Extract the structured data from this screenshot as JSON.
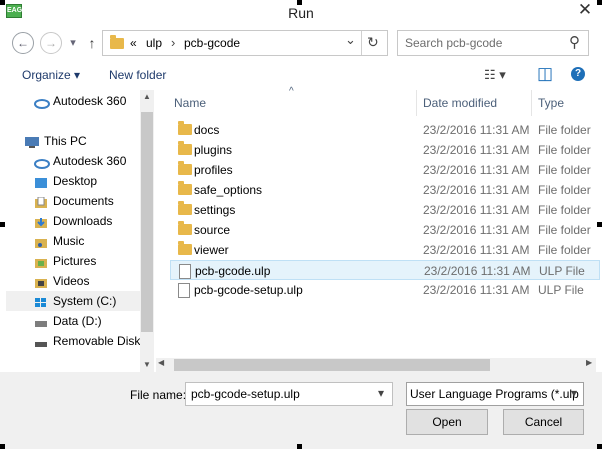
{
  "window": {
    "title": "Run",
    "close_glyph": "✕",
    "app_icon_text": "EAGLE"
  },
  "navigation": {
    "back_glyph": "←",
    "forward_glyph": "→",
    "recent_glyph": "▾",
    "up_glyph": "↑",
    "breadcrumb": {
      "overflow": "«",
      "sep": "›",
      "items": [
        "ulp",
        "pcb-gcode"
      ]
    },
    "dropdown_glyph": "⌄",
    "refresh_glyph": "↻"
  },
  "search": {
    "placeholder": "Search pcb-gcode",
    "icon_glyph": "⚲"
  },
  "toolbar": {
    "organize_label": "Organize ▾",
    "new_folder_label": "New folder",
    "view_glyph": "☷ ▾",
    "pane_glyph": "◫",
    "help_glyph": "?"
  },
  "sidebar": {
    "items": [
      {
        "label": "Autodesk 360",
        "icon": "cloud-icon",
        "color": "#3b7fc4"
      },
      {
        "label": "This PC",
        "icon": "computer-icon",
        "color": "#4a7bb5"
      },
      {
        "label": "Autodesk 360",
        "icon": "cloud-icon",
        "color": "#3b7fc4"
      },
      {
        "label": "Desktop",
        "icon": "desktop-icon",
        "color": "#3b8fd8"
      },
      {
        "label": "Documents",
        "icon": "documents-icon",
        "color": "#d9b250"
      },
      {
        "label": "Downloads",
        "icon": "downloads-icon",
        "color": "#2f7bd1"
      },
      {
        "label": "Music",
        "icon": "music-icon",
        "color": "#d9b250"
      },
      {
        "label": "Pictures",
        "icon": "pictures-icon",
        "color": "#d9b250"
      },
      {
        "label": "Videos",
        "icon": "videos-icon",
        "color": "#d9b250"
      },
      {
        "label": "System (C:)",
        "icon": "windows-drive-icon",
        "color": "#1b8ad6"
      },
      {
        "label": "Data (D:)",
        "icon": "drive-icon",
        "color": "#7d7d7d"
      },
      {
        "label": "Removable Disk (",
        "icon": "removable-disk-icon",
        "color": "#555555"
      }
    ]
  },
  "columns": {
    "name": "Name",
    "date": "Date modified",
    "type": "Type",
    "sort_glyph": "^"
  },
  "files": [
    {
      "name": "docs",
      "date": "23/2/2016 11:31 AM",
      "type": "File folder",
      "kind": "folder"
    },
    {
      "name": "plugins",
      "date": "23/2/2016 11:31 AM",
      "type": "File folder",
      "kind": "folder"
    },
    {
      "name": "profiles",
      "date": "23/2/2016 11:31 AM",
      "type": "File folder",
      "kind": "folder"
    },
    {
      "name": "safe_options",
      "date": "23/2/2016 11:31 AM",
      "type": "File folder",
      "kind": "folder"
    },
    {
      "name": "settings",
      "date": "23/2/2016 11:31 AM",
      "type": "File folder",
      "kind": "folder"
    },
    {
      "name": "source",
      "date": "23/2/2016 11:31 AM",
      "type": "File folder",
      "kind": "folder"
    },
    {
      "name": "viewer",
      "date": "23/2/2016 11:31 AM",
      "type": "File folder",
      "kind": "folder"
    },
    {
      "name": "pcb-gcode.ulp",
      "date": "23/2/2016 11:31 AM",
      "type": "ULP File",
      "kind": "file"
    },
    {
      "name": "pcb-gcode-setup.ulp",
      "date": "23/2/2016 11:31 AM",
      "type": "ULP File",
      "kind": "file"
    }
  ],
  "scroll": {
    "up_glyph": "▲",
    "down_glyph": "▼",
    "left_glyph": "◀",
    "right_glyph": "▶"
  },
  "footer": {
    "file_name_label": "File name:",
    "file_name_value": "pcb-gcode-setup.ulp",
    "filter_value": "User Language Programs (*.ulp",
    "dropdown_glyph": "▾",
    "open_label": "Open",
    "cancel_label": "Cancel"
  },
  "colors": {
    "accent": "#1e3a6b",
    "selection": "#e5f3fb",
    "folder": "#e8b84a"
  }
}
